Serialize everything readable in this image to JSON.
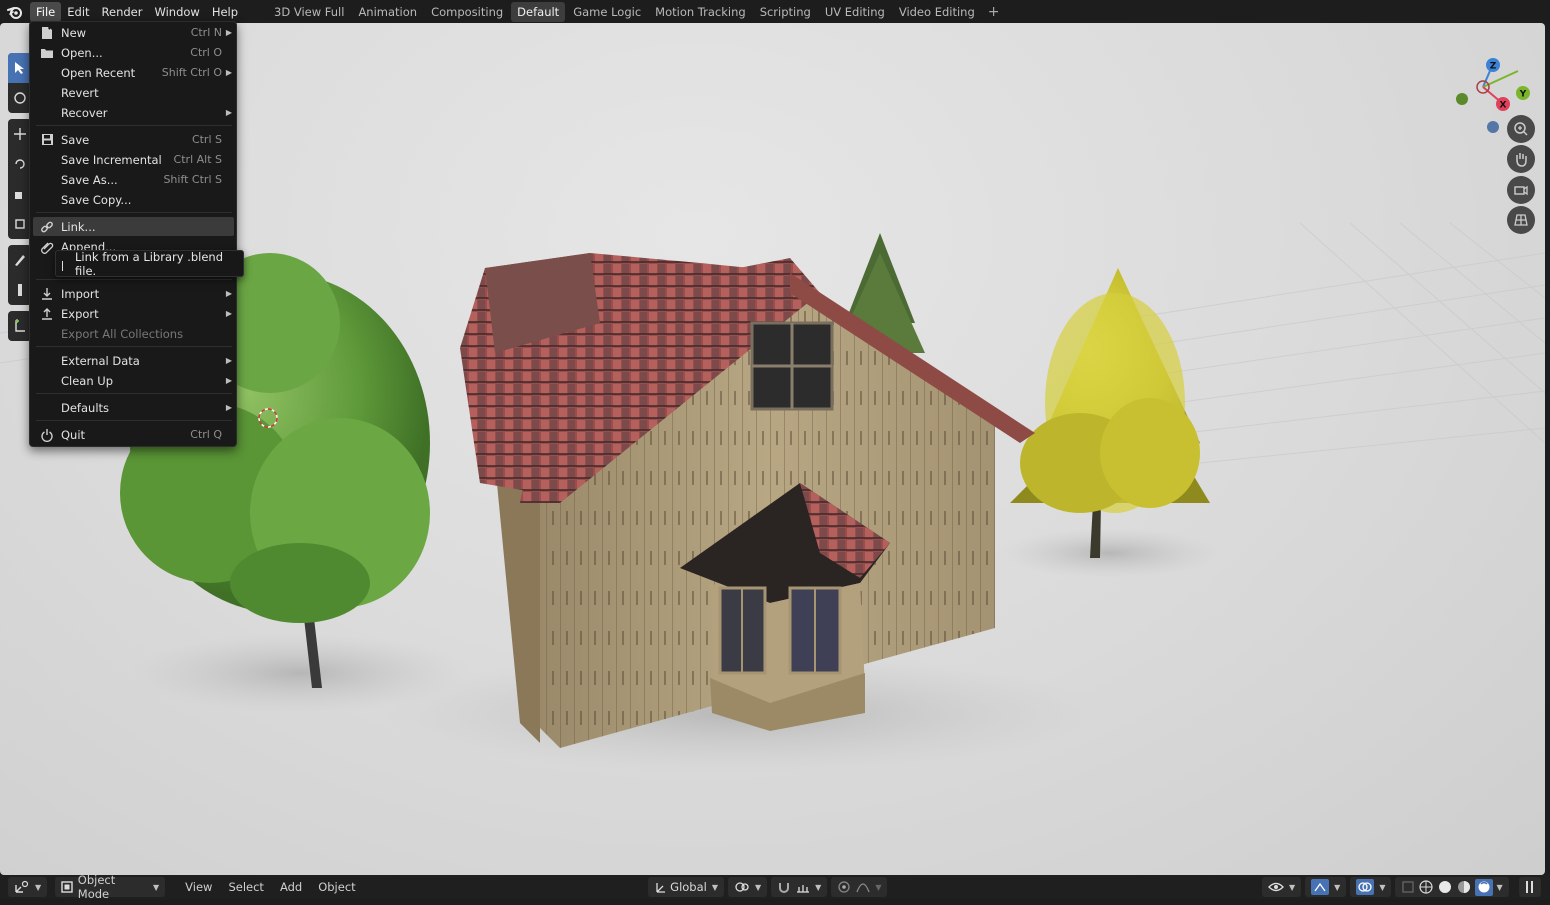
{
  "topbar": {
    "menus": [
      "File",
      "Edit",
      "Render",
      "Window",
      "Help"
    ],
    "active_menu": "File",
    "tabs": [
      "3D View Full",
      "Animation",
      "Compositing",
      "Default",
      "Game Logic",
      "Motion Tracking",
      "Scripting",
      "UV Editing",
      "Video Editing"
    ],
    "active_tab": "Default",
    "add_tab": "+"
  },
  "file_menu": {
    "items": [
      {
        "label": "New",
        "shortcut": "Ctrl N",
        "submenu": true,
        "icon": "new-file-icon"
      },
      {
        "label": "Open...",
        "shortcut": "Ctrl O",
        "submenu": false,
        "icon": "folder-icon"
      },
      {
        "label": "Open Recent",
        "shortcut": "Shift Ctrl O",
        "submenu": true,
        "icon": ""
      },
      {
        "label": "Revert",
        "shortcut": "",
        "submenu": false,
        "icon": ""
      },
      {
        "label": "Recover",
        "shortcut": "",
        "submenu": true,
        "icon": ""
      },
      {
        "label": "Save",
        "shortcut": "Ctrl S",
        "submenu": false,
        "icon": "save-icon"
      },
      {
        "label": "Save Incremental",
        "shortcut": "Ctrl Alt S",
        "submenu": false,
        "icon": ""
      },
      {
        "label": "Save As...",
        "shortcut": "Shift Ctrl S",
        "submenu": false,
        "icon": ""
      },
      {
        "label": "Save Copy...",
        "shortcut": "",
        "submenu": false,
        "icon": ""
      },
      {
        "label": "Link...",
        "shortcut": "",
        "submenu": false,
        "icon": "link-icon"
      },
      {
        "label": "Append...",
        "shortcut": "",
        "submenu": false,
        "icon": "append-icon"
      },
      {
        "label": "Import",
        "shortcut": "",
        "submenu": true,
        "icon": "import-icon"
      },
      {
        "label": "Export",
        "shortcut": "",
        "submenu": true,
        "icon": "export-icon"
      },
      {
        "label": "Export All Collections",
        "shortcut": "",
        "submenu": false,
        "icon": "",
        "disabled": true
      },
      {
        "label": "External Data",
        "shortcut": "",
        "submenu": true,
        "icon": ""
      },
      {
        "label": "Clean Up",
        "shortcut": "",
        "submenu": true,
        "icon": ""
      },
      {
        "label": "Defaults",
        "shortcut": "",
        "submenu": true,
        "icon": ""
      },
      {
        "label": "Quit",
        "shortcut": "Ctrl Q",
        "submenu": false,
        "icon": "power-icon"
      }
    ],
    "hovered": "Link..."
  },
  "tooltip": {
    "text": "Link from a Library .blend file."
  },
  "gizmo": {
    "x": "X",
    "y": "Y",
    "z": "Z",
    "x_color": "#e0405a",
    "y_color": "#7bb52c",
    "z_color": "#3b82d6"
  },
  "bottombar": {
    "mode": "Object Mode",
    "menus": [
      "View",
      "Select",
      "Add",
      "Object"
    ],
    "orientation": "Global"
  },
  "colors": {
    "accent": "#4772b3",
    "menu_bg": "#191919",
    "hover_bg": "#3b3b3b"
  }
}
